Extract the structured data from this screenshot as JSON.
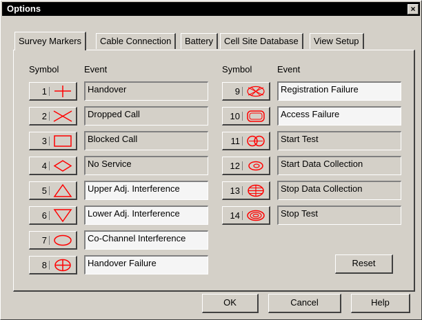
{
  "window": {
    "title": "Options",
    "close_glyph": "×"
  },
  "tabs": [
    "Survey Markers",
    "Cable Connection",
    "Battery",
    "Cell Site Database",
    "View Setup"
  ],
  "headers": {
    "symbol": "Symbol",
    "event": "Event"
  },
  "left_markers": [
    {
      "num": "1",
      "icon": "plus-icon",
      "event": "Handover",
      "field_style": "gray"
    },
    {
      "num": "2",
      "icon": "x-cross-icon",
      "event": "Dropped Call",
      "field_style": "gray"
    },
    {
      "num": "3",
      "icon": "rectangle-icon",
      "event": "Blocked Call",
      "field_style": "gray"
    },
    {
      "num": "4",
      "icon": "diamond-icon",
      "event": "No Service",
      "field_style": "gray"
    },
    {
      "num": "5",
      "icon": "triangle-up-icon",
      "event": "Upper Adj. Interference",
      "field_style": "white"
    },
    {
      "num": "6",
      "icon": "triangle-down-icon",
      "event": "Lower Adj. Interference",
      "field_style": "white"
    },
    {
      "num": "7",
      "icon": "ellipse-icon",
      "event": "Co-Channel Interference",
      "field_style": "white"
    },
    {
      "num": "8",
      "icon": "circle-cross-icon",
      "event": "Handover Failure",
      "field_style": "white"
    }
  ],
  "right_markers": [
    {
      "num": "9",
      "icon": "hatched-bowtie-icon",
      "event": "Registration Failure",
      "field_style": "white"
    },
    {
      "num": "10",
      "icon": "rounded-box-icon",
      "event": "Access Failure",
      "field_style": "white"
    },
    {
      "num": "11",
      "icon": "crossed-loops-icon",
      "event": "Start Test",
      "field_style": "gray"
    },
    {
      "num": "12",
      "icon": "spiral-icon",
      "event": "Start Data Collection",
      "field_style": "gray"
    },
    {
      "num": "13",
      "icon": "gridded-circle-icon",
      "event": "Stop Data Collection",
      "field_style": "gray"
    },
    {
      "num": "14",
      "icon": "concentric-ellipse-icon",
      "event": "Stop Test",
      "field_style": "gray"
    }
  ],
  "buttons": {
    "reset": "Reset",
    "ok": "OK",
    "cancel": "Cancel",
    "help": "Help"
  },
  "colors": {
    "face": "#d4d0c8",
    "title_bar": "#000000",
    "symbol": "#ff0000",
    "field_white": "#f5f5f5"
  }
}
